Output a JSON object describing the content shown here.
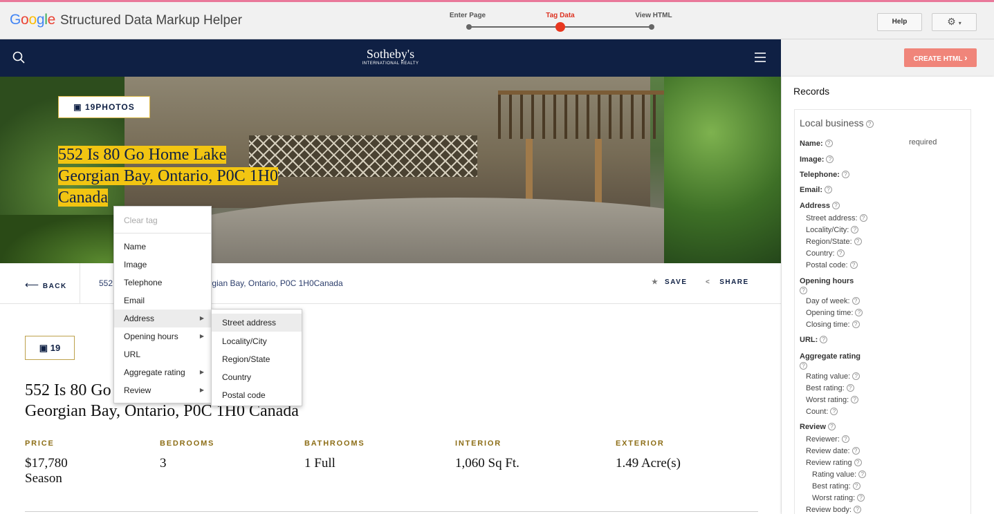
{
  "app": {
    "logo": [
      "G",
      "o",
      "o",
      "g",
      "l",
      "e"
    ],
    "title": "Structured Data Markup Helper",
    "steps": [
      {
        "label": "Enter Page"
      },
      {
        "label": "Tag Data"
      },
      {
        "label": "View HTML"
      }
    ],
    "help_label": "Help",
    "settings_icon": "gear-icon"
  },
  "site": {
    "brand": "Sotheby's",
    "brand_sub": "INTERNATIONAL REALTY",
    "photos_label": "19PHOTOS",
    "hero_title_lines": [
      "552 Is 80 Go Home Lake",
      "Georgian Bay, Ontario, P0C 1H0",
      "Canada"
    ],
    "back_label": "BACK",
    "address_bar": "552 Is 80 Go Home Lake Georgian Bay, Ontario, P0C 1H0Canada",
    "save_label": "SAVE",
    "share_label": "SHARE",
    "photos_count": "19",
    "title_lines": [
      "552 Is 80 Go Home Lake",
      "Georgian Bay, Ontario, P0C 1H0 Canada"
    ],
    "facts": [
      {
        "label": "PRICE",
        "value": "$17,780 Season"
      },
      {
        "label": "BEDROOMS",
        "value": "3"
      },
      {
        "label": "BATHROOMS",
        "value": "1 Full"
      },
      {
        "label": "INTERIOR",
        "value": "1,060 Sq Ft."
      },
      {
        "label": "EXTERIOR",
        "value": "1.49 Acre(s)"
      }
    ]
  },
  "context_menu": {
    "items": [
      {
        "label": "Clear tag"
      },
      {
        "label": "Name"
      },
      {
        "label": "Image"
      },
      {
        "label": "Telephone"
      },
      {
        "label": "Email"
      },
      {
        "label": "Address"
      },
      {
        "label": "Opening hours"
      },
      {
        "label": "URL"
      },
      {
        "label": "Aggregate rating"
      },
      {
        "label": "Review"
      }
    ],
    "submenu": [
      "Street address",
      "Locality/City",
      "Region/State",
      "Country",
      "Postal code"
    ]
  },
  "panel": {
    "create_label": "CREATE HTML",
    "records_title": "Records",
    "local_business": "Local business",
    "required": "required",
    "fields": [
      {
        "label": "Name:"
      },
      {
        "label": "Image:"
      },
      {
        "label": "Telephone:"
      },
      {
        "label": "Email:"
      },
      {
        "label": "Address"
      },
      {
        "label": "Street address:"
      },
      {
        "label": "Locality/City:"
      },
      {
        "label": "Region/State:"
      },
      {
        "label": "Country:"
      },
      {
        "label": "Postal code:"
      },
      {
        "label": "Opening hours"
      },
      {
        "label": "Day of week:"
      },
      {
        "label": "Opening time:"
      },
      {
        "label": "Closing time:"
      },
      {
        "label": "URL:"
      },
      {
        "label": "Aggregate rating"
      },
      {
        "label": "Rating value:"
      },
      {
        "label": "Best rating:"
      },
      {
        "label": "Worst rating:"
      },
      {
        "label": "Count:"
      },
      {
        "label": "Review"
      },
      {
        "label": "Reviewer:"
      },
      {
        "label": "Review date:"
      },
      {
        "label": "Review rating"
      },
      {
        "label": "Rating value:"
      },
      {
        "label": "Best rating:"
      },
      {
        "label": "Worst rating:"
      },
      {
        "label": "Review body:"
      }
    ]
  }
}
